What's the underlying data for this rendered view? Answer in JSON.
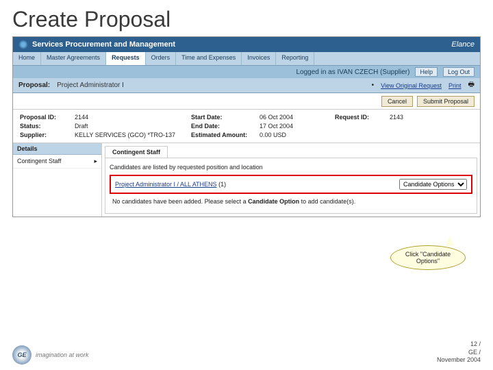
{
  "slide_title": "Create Proposal",
  "app": {
    "title": "Services Procurement and Management",
    "brand": "Elance"
  },
  "tabs": [
    "Home",
    "Master Agreements",
    "Requests",
    "Orders",
    "Time and Expenses",
    "Invoices",
    "Reporting"
  ],
  "active_tab": "Requests",
  "subbar": {
    "logged_in": "Logged in as IVAN CZECH (Supplier)",
    "help": "Help",
    "logout": "Log Out"
  },
  "proposal": {
    "label": "Proposal:",
    "value": "Project Administrator I",
    "view_link": "View Original Request",
    "print": "Print"
  },
  "actions": {
    "cancel": "Cancel",
    "submit": "Submit Proposal"
  },
  "info": {
    "proposal_id_lbl": "Proposal ID:",
    "proposal_id": "2144",
    "status_lbl": "Status:",
    "status": "Draft",
    "supplier_lbl": "Supplier:",
    "supplier": "KELLY SERVICES (GCO) *TRO-137",
    "start_lbl": "Start Date:",
    "start": "06 Oct 2004",
    "end_lbl": "End Date:",
    "end": "17 Oct 2004",
    "amount_lbl": "Estimated Amount:",
    "amount": "0.00 USD",
    "request_id_lbl": "Request ID:",
    "request_id": "2143"
  },
  "details": {
    "header": "Details",
    "side_item": "Contingent Staff",
    "main_tab": "Contingent Staff",
    "list_note": "Candidates are listed by requested position and location",
    "candidate_link": "Project Administrator I / ALL ATHENS",
    "candidate_count": "(1)",
    "dropdown": "Candidate Options",
    "hint_pre": "No candidates have been added. Please select a ",
    "hint_bold": "Candidate Option",
    "hint_post": " to add candidate(s)."
  },
  "callout": "Click \"Candidate Options\"",
  "footer": {
    "logo_text": "GE",
    "tagline": "imagination at work",
    "page": "12 /",
    "org": "GE /",
    "date": "November 2004"
  }
}
